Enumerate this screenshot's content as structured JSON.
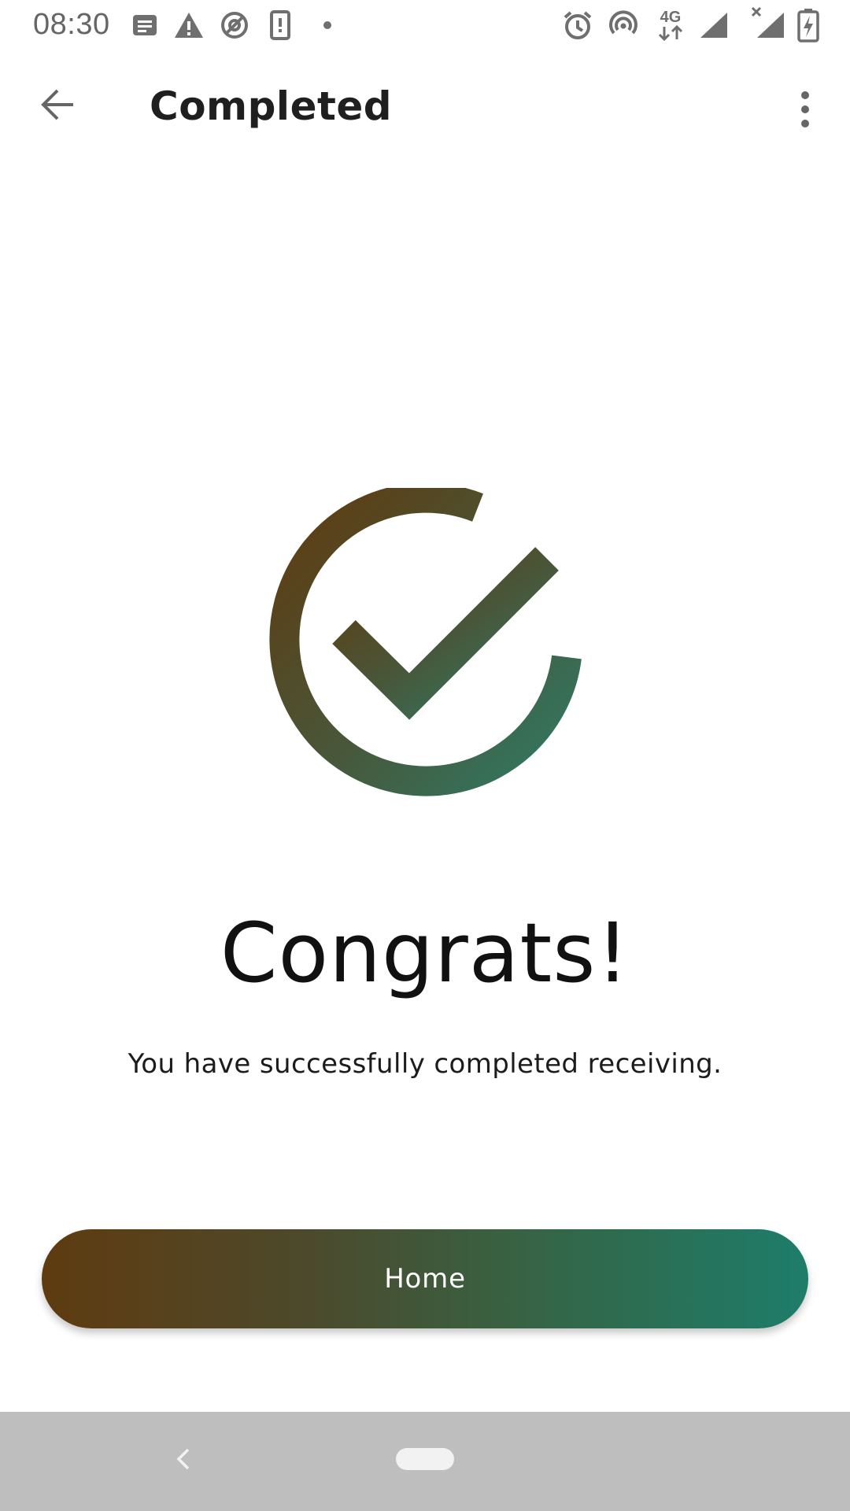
{
  "status_bar": {
    "time": "08:30",
    "left_icons": [
      "notification-message-icon",
      "warning-icon",
      "vpn-icon",
      "device-alert-icon",
      "more-dot-icon"
    ],
    "right_icons": [
      "alarm-icon",
      "hotspot-icon",
      "4g-icon",
      "signal-icon",
      "no-signal-icon",
      "battery-charging-icon"
    ],
    "network_label": "4G"
  },
  "app_bar": {
    "title": "Completed",
    "back_icon": "arrow-back-icon",
    "menu_icon": "more-vert-icon"
  },
  "main": {
    "graphic_icon": "check-circle-icon",
    "heading": "Congrats!",
    "message": "You have successfully completed receiving.",
    "primary_button_label": "Home"
  },
  "colors": {
    "gradient_start": "#5f3b10",
    "gradient_end": "#1d7d6a",
    "nav_bar": "#bebebe"
  },
  "nav_bar": {
    "back_icon": "nav-back-icon",
    "home_icon": "nav-home-pill-icon"
  }
}
